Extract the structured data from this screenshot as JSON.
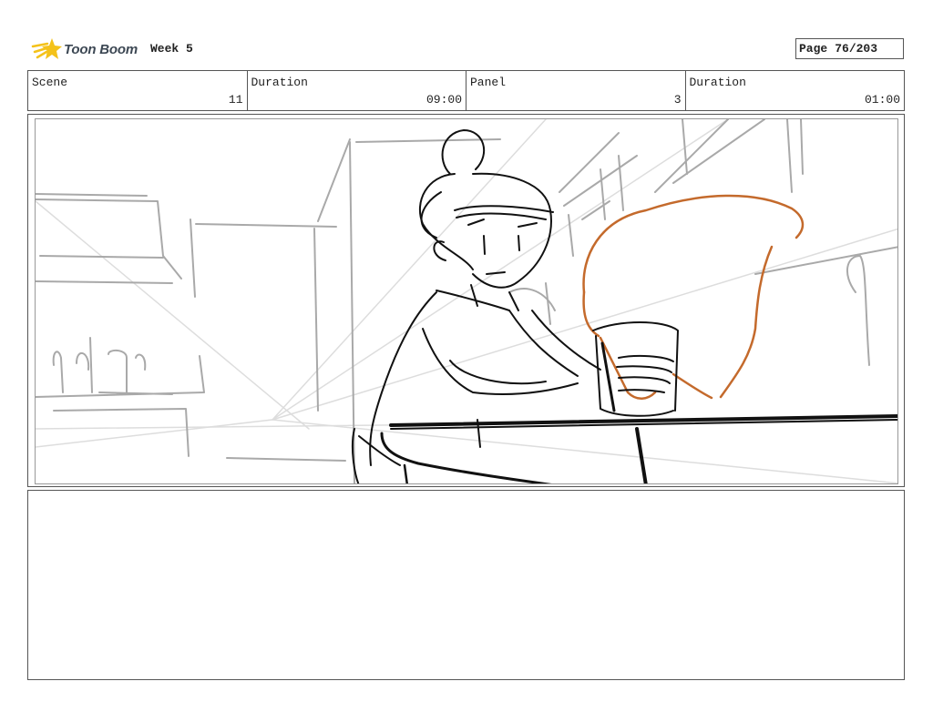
{
  "header": {
    "logo_text": "Toon Boom",
    "logo_icon": "comet-star-icon",
    "project": "Week 5",
    "page_label": "Page",
    "page_number": "76/203"
  },
  "info": {
    "scene_label": "Scene",
    "scene_value": "11",
    "scene_duration_label": "Duration",
    "scene_duration_value": "09:00",
    "panel_label": "Panel",
    "panel_value": "3",
    "panel_duration_label": "Duration",
    "panel_duration_value": "01:00"
  },
  "colors": {
    "sketch": "#111111",
    "guide": "#b8b8b8",
    "accent": "#c46a2c",
    "logo_yellow": "#f4c21a"
  }
}
